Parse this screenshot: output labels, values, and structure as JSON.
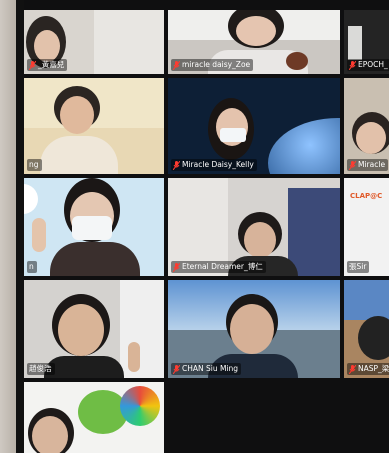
{
  "participants": [
    {
      "name": "_黃嘉兒",
      "muted": true
    },
    {
      "name": "miracle daisy_Zoe",
      "muted": true
    },
    {
      "name": "EPOCH_",
      "muted": true
    },
    {
      "name": "ng",
      "muted": false
    },
    {
      "name": "Miracle Daisy_Kelly",
      "muted": true
    },
    {
      "name": "Miracle",
      "muted": true
    },
    {
      "name": "n",
      "muted": false
    },
    {
      "name": "Eternal Dreamer_博仁",
      "muted": true
    },
    {
      "name": "張Sir",
      "muted": false
    },
    {
      "name": "趙俊浩",
      "muted": false
    },
    {
      "name": "CHAN Siu Ming",
      "muted": true
    },
    {
      "name": "NASP_梁",
      "muted": true
    }
  ],
  "logo_text": "CLAP@C",
  "colors": {
    "muted_mic": "#ff3b30",
    "label_bg": "rgba(0,0,0,0.45)"
  }
}
